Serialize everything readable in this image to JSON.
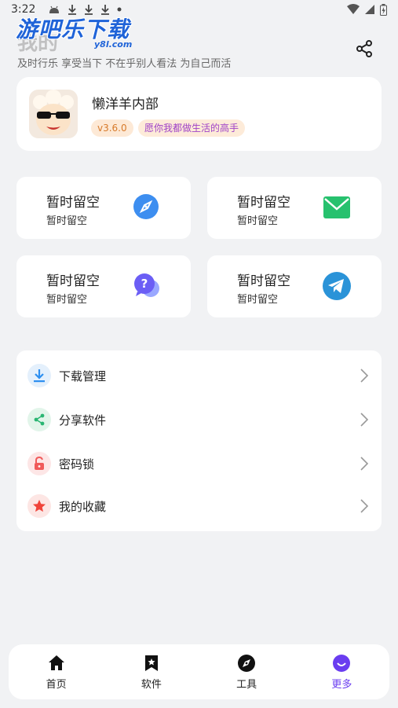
{
  "status_bar": {
    "time": "3:22"
  },
  "watermark": {
    "text": "游吧乐下载",
    "sub": "y8l.com"
  },
  "header": {
    "title": "我的",
    "subtitle": "及时行乐 享受当下 不在乎别人看法 为自己而活"
  },
  "profile": {
    "name": "懒洋羊内部",
    "version": "v3.6.0",
    "motto": "愿你我都做生活的高手"
  },
  "tiles": [
    {
      "title": "暂时留空",
      "subtitle": "暂时留空",
      "icon": "compass-icon"
    },
    {
      "title": "暂时留空",
      "subtitle": "暂时留空",
      "icon": "mail-icon"
    },
    {
      "title": "暂时留空",
      "subtitle": "暂时留空",
      "icon": "question-chat-icon"
    },
    {
      "title": "暂时留空",
      "subtitle": "暂时留空",
      "icon": "telegram-icon"
    }
  ],
  "menu": [
    {
      "label": "下载管理",
      "icon": "download-icon",
      "color": "#2d8ff0"
    },
    {
      "label": "分享软件",
      "icon": "share-icon",
      "color": "#2bb673"
    },
    {
      "label": "密码锁",
      "icon": "lock-icon",
      "color": "#f05a5a"
    },
    {
      "label": "我的收藏",
      "icon": "star-icon",
      "color": "#f0443a"
    }
  ],
  "bottom_nav": {
    "items": [
      {
        "label": "首页",
        "icon": "home-icon"
      },
      {
        "label": "软件",
        "icon": "bookmark-icon"
      },
      {
        "label": "工具",
        "icon": "compass-icon"
      },
      {
        "label": "更多",
        "icon": "smile-icon",
        "active": true
      }
    ]
  },
  "colors": {
    "accent": "#6a3df0",
    "background": "#f1f2f4"
  }
}
